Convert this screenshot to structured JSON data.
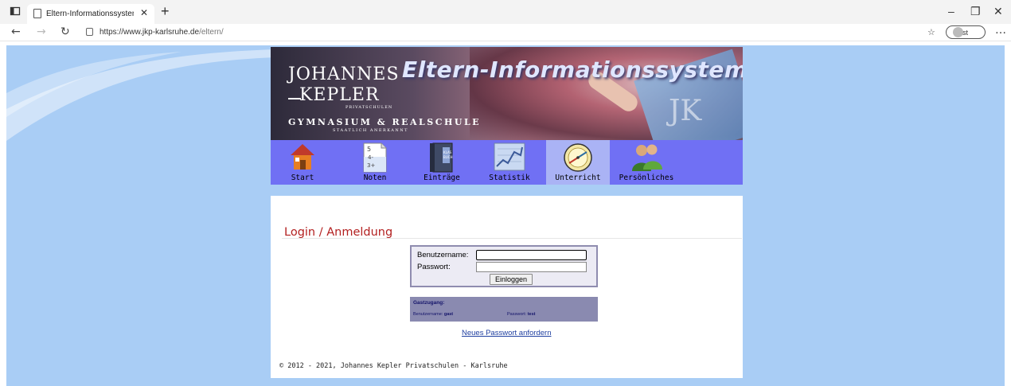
{
  "browser": {
    "tab_title": "Eltern-Informationssystem (EIS)",
    "url_host": "https://www.jkp-karlsruhe.de",
    "url_path": "/eltern/",
    "profile_label": "Gast"
  },
  "banner": {
    "system_title": "Eltern-Informationssystem",
    "logo_line1": "JOHANNES",
    "logo_line2": "KEPLER",
    "logo_line3": "PRIVATSCHULEN",
    "logo_line4": "GYMNASIUM & REALSCHULE",
    "logo_line5": "STAATLICH ANERKANNT",
    "watermark": "JK"
  },
  "nav": {
    "items": [
      {
        "label": "Start",
        "icon": "house-icon"
      },
      {
        "label": "Noten",
        "icon": "grades-icon"
      },
      {
        "label": "Einträge",
        "icon": "classbook-icon"
      },
      {
        "label": "Statistik",
        "icon": "chart-icon"
      },
      {
        "label": "Unterricht",
        "icon": "clock-icon"
      },
      {
        "label": "Persönliches",
        "icon": "people-icon"
      }
    ],
    "active": "Unterricht"
  },
  "login": {
    "title": "Login / Anmeldung",
    "username_label": "Benutzername:",
    "password_label": "Passwort:",
    "username_value": "",
    "password_value": "",
    "submit_label": "Einloggen"
  },
  "guest": {
    "heading": "Gastzugang:",
    "user_label": "Benutzername: ",
    "user_value": "gast",
    "pass_label": "Passwort: ",
    "pass_value": "test"
  },
  "links": {
    "reset_password": "Neues Passwort anfordern"
  },
  "footer": {
    "copyright": "© 2012 - 2021, Johannes Kepler Privatschulen - Karlsruhe"
  }
}
